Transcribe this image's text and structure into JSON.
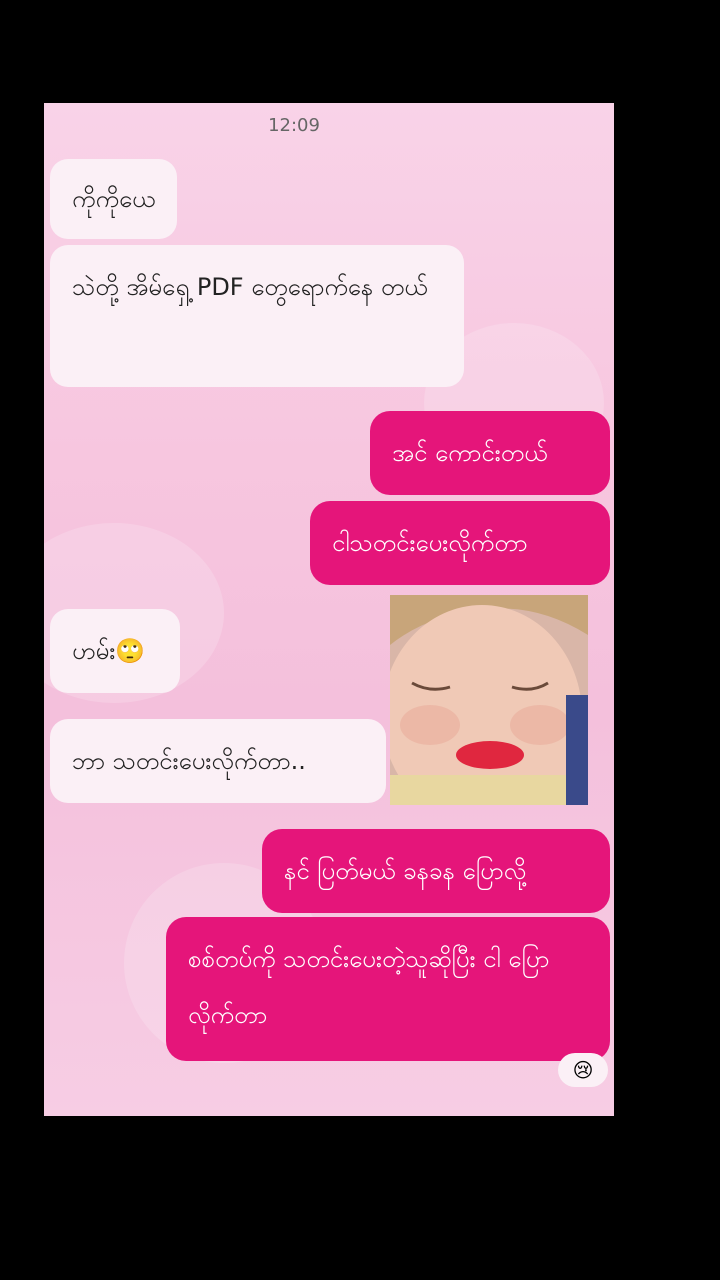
{
  "status": {
    "time": "12:09"
  },
  "messages": [
    {
      "text": "ကိုကိုယေ"
    },
    {
      "text": "သဲတို့ အိမ်ရှေ့ PDF တွေရောက်နေ တယ်"
    },
    {
      "text": "အင် ကောင်းတယ်"
    },
    {
      "text": "ငါသတင်းပေးလိုက်တာ"
    },
    {
      "text": "ဟမ်း🙄"
    },
    {
      "text": "ဘာ သတင်းပေးလိုက်တာ.."
    },
    {
      "text": "နင် ပြတ်မယ် ခနခန ပြောလို့"
    },
    {
      "text": "စစ်တပ်ကို သတင်းပေးတဲ့သူဆိုပြီး ငါ ပြောလိုက်တာ"
    }
  ],
  "reaction": {
    "emoji": "😢"
  },
  "colors": {
    "outgoing": "#e5157a",
    "incoming": "#fbf0f6",
    "background": "#f7c6df"
  },
  "icons": [
    "baby-photo"
  ]
}
